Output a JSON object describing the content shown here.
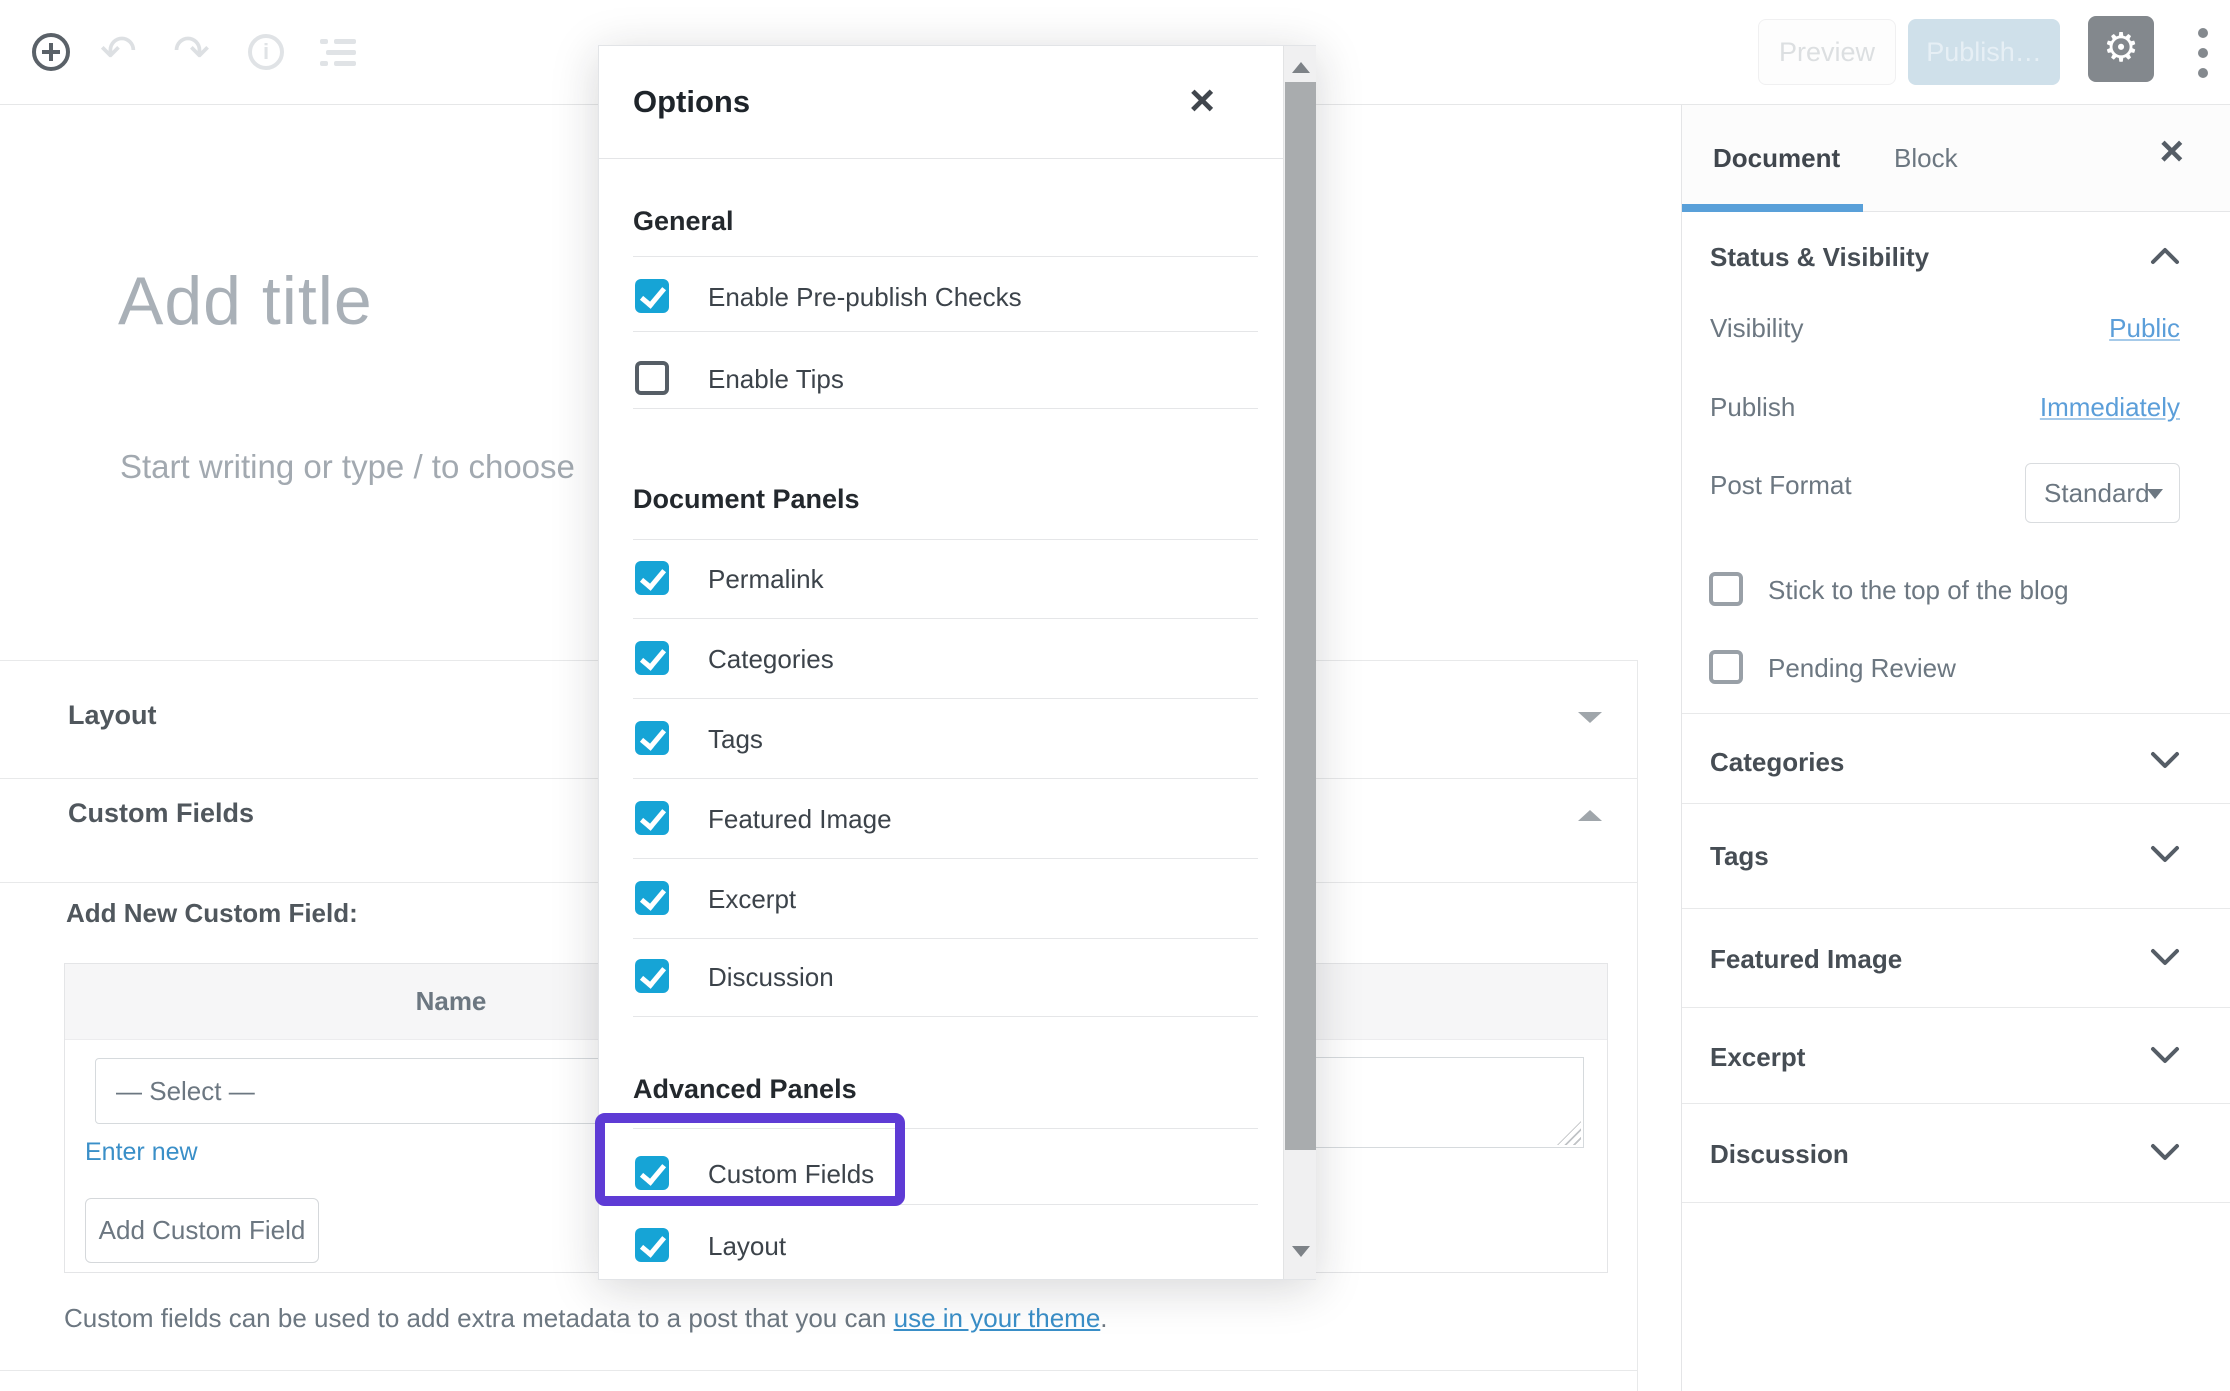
{
  "colors": {
    "accent_blue": "#16a4d6",
    "link_blue": "#3a8fc8",
    "sidebar_link_blue": "#5b9ed9",
    "tab_underline": "#59a0d9",
    "highlight_purple": "#5e3bd5"
  },
  "toolbar": {
    "preview_label": "Preview",
    "publish_label": "Publish…",
    "gear_glyph": "⚙",
    "undo_glyph": "↶",
    "redo_glyph": "↷",
    "info_glyph": "i"
  },
  "modal": {
    "title": "Options",
    "close_glyph": "×",
    "sections": [
      {
        "heading": "General",
        "items": [
          {
            "label": "Enable Pre-publish Checks",
            "checked": true
          },
          {
            "label": "Enable Tips",
            "checked": false
          }
        ]
      },
      {
        "heading": "Document Panels",
        "items": [
          {
            "label": "Permalink",
            "checked": true
          },
          {
            "label": "Categories",
            "checked": true
          },
          {
            "label": "Tags",
            "checked": true
          },
          {
            "label": "Featured Image",
            "checked": true
          },
          {
            "label": "Excerpt",
            "checked": true
          },
          {
            "label": "Discussion",
            "checked": true
          }
        ]
      },
      {
        "heading": "Advanced Panels",
        "items": [
          {
            "label": "Custom Fields",
            "checked": true,
            "highlighted": true
          },
          {
            "label": "Layout",
            "checked": true
          }
        ]
      }
    ]
  },
  "editor": {
    "title_placeholder": "Add title",
    "body_placeholder": "Start writing or type / to choose",
    "panels": [
      {
        "label": "Layout",
        "state": "collapsed"
      },
      {
        "label": "Custom Fields",
        "state": "expanded"
      }
    ],
    "custom_fields": {
      "add_new_label": "Add New Custom Field:",
      "name_header": "Name",
      "select_value": "— Select —",
      "enter_new_label": "Enter new",
      "add_button_label": "Add Custom Field",
      "help_text_before": "Custom fields can be used to add extra metadata to a post that you can ",
      "help_link_label": "use in your theme",
      "help_text_after": "."
    }
  },
  "sidebar": {
    "close_glyph": "×",
    "tabs": [
      {
        "label": "Document",
        "active": true
      },
      {
        "label": "Block",
        "active": false
      }
    ],
    "status_panel": {
      "title": "Status & Visibility",
      "rows": [
        {
          "label": "Visibility",
          "value": "Public"
        },
        {
          "label": "Publish",
          "value": "Immediately"
        },
        {
          "label": "Post Format",
          "value": "Standard"
        }
      ],
      "checkboxes": [
        {
          "label": "Stick to the top of the blog",
          "checked": false
        },
        {
          "label": "Pending Review",
          "checked": false
        }
      ]
    },
    "panels": [
      {
        "label": "Categories"
      },
      {
        "label": "Tags"
      },
      {
        "label": "Featured Image"
      },
      {
        "label": "Excerpt"
      },
      {
        "label": "Discussion"
      }
    ]
  }
}
